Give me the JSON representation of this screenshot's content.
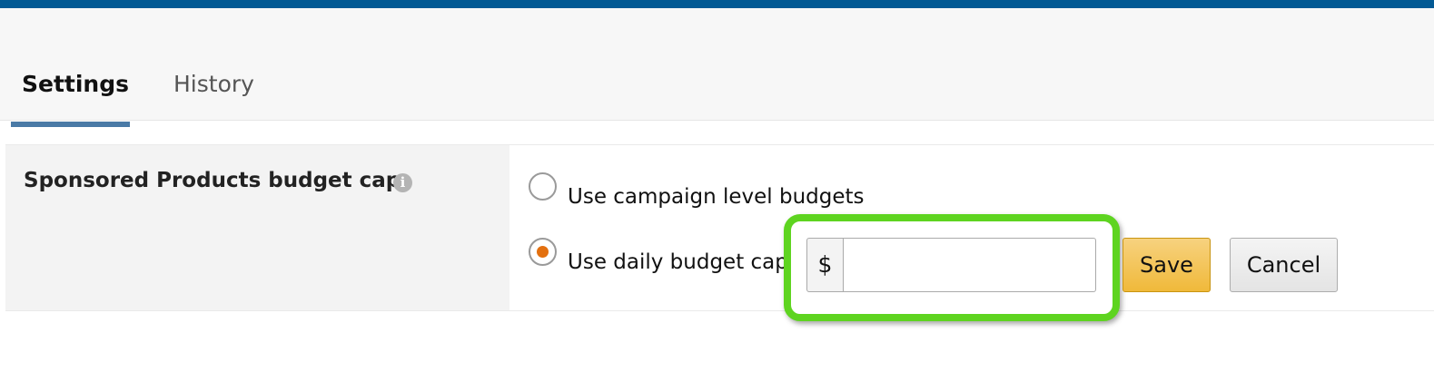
{
  "tabs": {
    "settings": "Settings",
    "history": "History"
  },
  "budget_cap": {
    "label": "Sponsored Products budget cap",
    "info_icon": "info-icon",
    "option_campaign": "Use campaign level budgets",
    "option_daily": "Use daily budget cap",
    "selected_option": "daily",
    "currency_symbol": "$",
    "amount_value": "",
    "save_label": "Save",
    "cancel_label": "Cancel"
  },
  "colors": {
    "top_bar": "#035a94",
    "tab_underline": "#4a7aa6",
    "radio_selected": "#e3700f",
    "highlight": "#5ed420",
    "save_button": "#f0b93a"
  }
}
